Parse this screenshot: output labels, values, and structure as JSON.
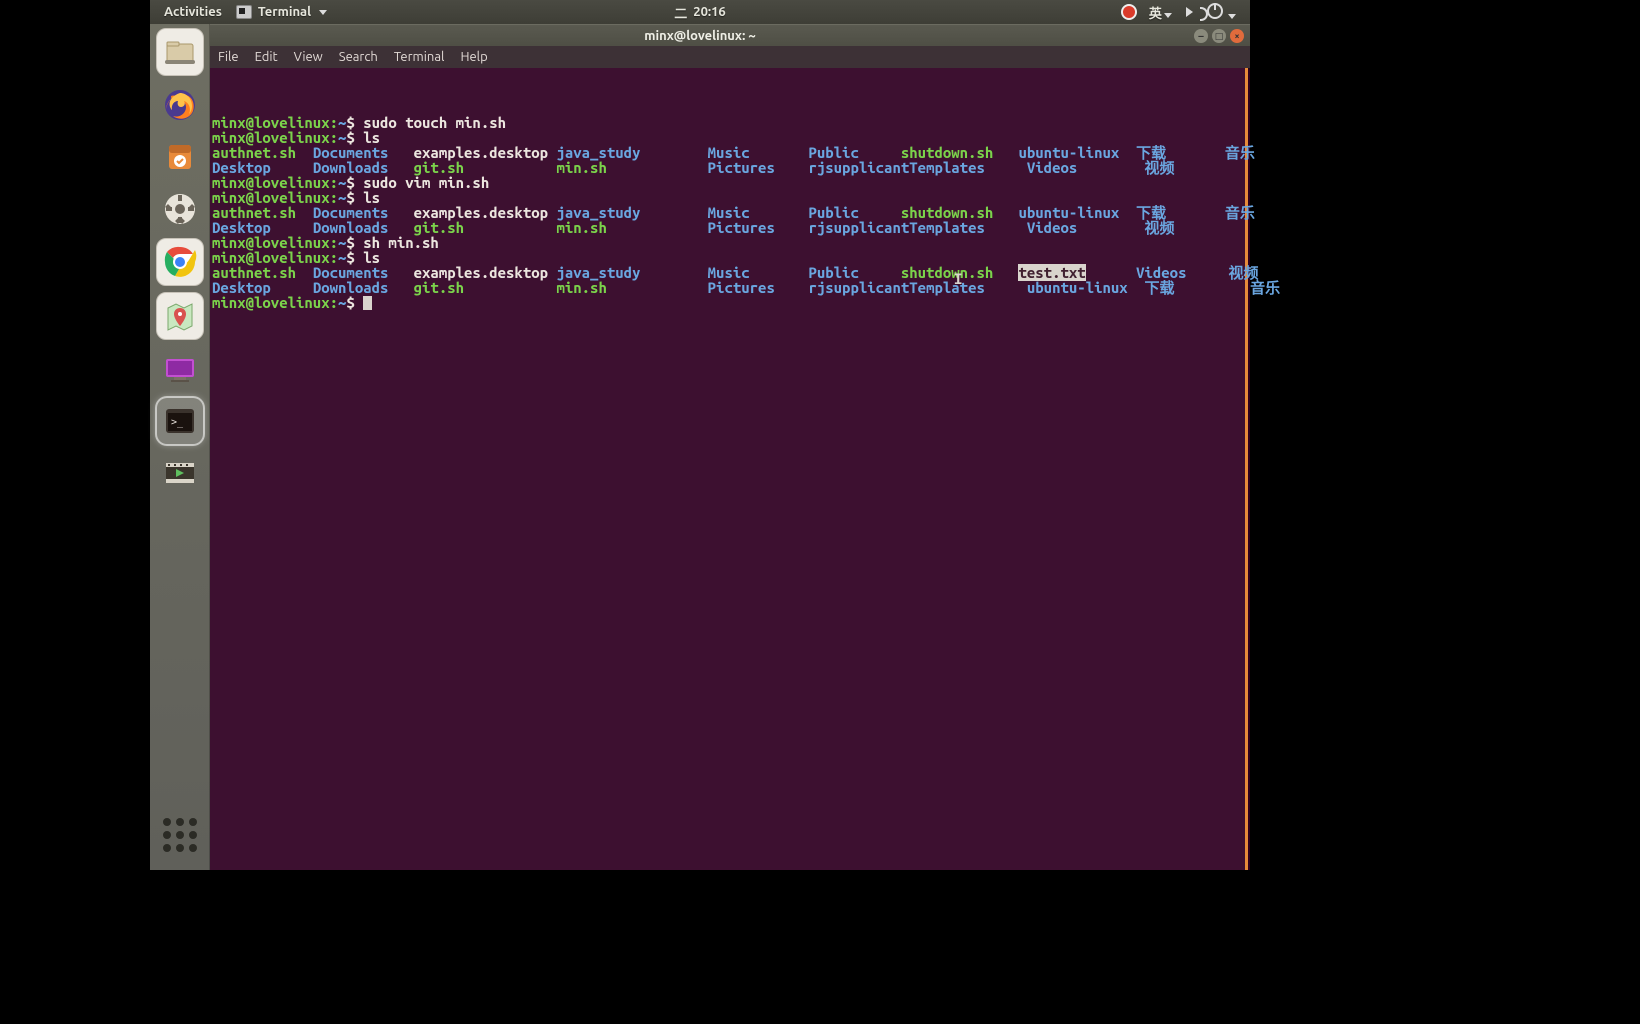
{
  "topbar": {
    "activities": "Activities",
    "app": "Terminal",
    "clock_prefix": "二",
    "time": "20:16",
    "lang": "英"
  },
  "titlebar": {
    "title": "minx@lovelinux: ~"
  },
  "menubar": [
    "File",
    "Edit",
    "View",
    "Search",
    "Terminal",
    "Help"
  ],
  "prompt": {
    "userhost": "minx@lovelinux:",
    "path": "~",
    "sym": "$"
  },
  "cmds": {
    "c1": "sudo touch min.sh",
    "c2": "ls",
    "c3": "sudo vim min.sh",
    "c4": "ls",
    "c5": "sh min.sh",
    "c6": "ls"
  },
  "ls_ab": {
    "r1": [
      "authnet.sh",
      "Documents",
      "examples.desktop",
      "java_study",
      "Music",
      "Public",
      "shutdown.sh",
      "ubuntu-linux",
      "下载",
      "音乐"
    ],
    "r2": [
      "Desktop",
      "Downloads",
      "git.sh",
      "min.sh",
      "Pictures",
      "rjsupplicant",
      "Templates",
      "Videos",
      "视频"
    ],
    "kinds_r1": [
      "g",
      "b",
      "w",
      "b",
      "b",
      "b",
      "g",
      "b",
      "b",
      "b"
    ],
    "kinds_r2": [
      "b",
      "b",
      "g",
      "g",
      "b",
      "b",
      "b",
      "b",
      "b"
    ]
  },
  "ls_c": {
    "r1": [
      "authnet.sh",
      "Documents",
      "examples.desktop",
      "java_study",
      "Music",
      "Public",
      "shutdown.sh",
      "test.txt",
      "Videos",
      "视频"
    ],
    "r2": [
      "Desktop",
      "Downloads",
      "git.sh",
      "min.sh",
      "Pictures",
      "rjsupplicant",
      "Templates",
      "ubuntu-linux",
      "下载",
      "音乐"
    ],
    "kinds_r1": [
      "g",
      "b",
      "w",
      "b",
      "b",
      "b",
      "g",
      "hl",
      "b",
      "b"
    ],
    "kinds_r2": [
      "b",
      "b",
      "g",
      "g",
      "b",
      "b",
      "b",
      "b",
      "b",
      "b"
    ]
  },
  "cols": [
    0,
    12,
    24,
    41,
    59,
    71,
    82,
    96,
    110,
    119,
    126
  ],
  "cols_c": [
    0,
    12,
    24,
    41,
    59,
    71,
    82,
    96,
    110,
    121,
    128
  ],
  "dock": [
    {
      "name": "files-icon"
    },
    {
      "name": "firefox-icon"
    },
    {
      "name": "software-icon"
    },
    {
      "name": "settings-icon"
    },
    {
      "name": "chrome-icon"
    },
    {
      "name": "maps-icon"
    },
    {
      "name": "screenshot-icon"
    },
    {
      "name": "terminal-icon",
      "active": true
    },
    {
      "name": "video-editor-icon"
    }
  ],
  "ibeam": "I"
}
